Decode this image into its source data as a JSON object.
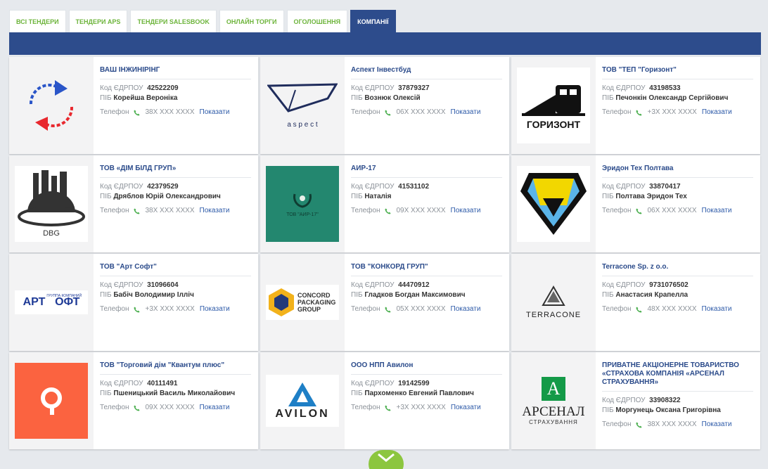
{
  "tabs": [
    {
      "label": "Всі тендери"
    },
    {
      "label": "Тендери APS"
    },
    {
      "label": "Тендери SalesBook"
    },
    {
      "label": "Онлайн торги"
    },
    {
      "label": "Оголошення"
    },
    {
      "label": "Компанії"
    }
  ],
  "labels": {
    "edrpou": "Код ЄДРПОУ",
    "pib": "ПІБ",
    "phone": "Телефон",
    "show": "Показати"
  },
  "logos": {
    "aspect_text": "a s p e c t",
    "horizont_text": "ГОРИЗОНТ",
    "dbg_text": "DBG",
    "air_text": "ТОВ \"АИР-17\"",
    "art_main": "АРТ",
    "art_soft": "ОФТ",
    "art_group": "ГРУППА КОМПАНИЙ",
    "concord_1": "CONCORD",
    "concord_2": "PACKAGING",
    "concord_3": "GROUP",
    "terracone_text": "TERRACONE",
    "avilon_text": "AVILON",
    "arsenal_letter": "A",
    "arsenal_main": "АРСЕНАЛ",
    "arsenal_sub": "СТРАХУВАННЯ"
  },
  "colors": {
    "brand_blue": "#2d4c8c",
    "tab_green": "#6db43b",
    "accent_green": "#8cc63f"
  },
  "companies": [
    {
      "name": "ВАШ ІНЖИНІРІНГ",
      "edrpou": "42522209",
      "pib": "Корейша Вероніка",
      "phone": "38X XXX XXXX"
    },
    {
      "name": "Аспект Інвестбуд",
      "edrpou": "37879327",
      "pib": "Вознюк Олексій",
      "phone": "06X XXX XXXX"
    },
    {
      "name": "ТОВ \"ТЕП \"Горизонт\"",
      "edrpou": "43198533",
      "pib": "Печонкін Олександр Сергійович",
      "phone": "+3X XXX XXXX"
    },
    {
      "name": "ТОВ «ДІМ БІЛД ГРУП»",
      "edrpou": "42379529",
      "pib": "Дряблов Юрій Олександрович",
      "phone": "38X XXX XXXX"
    },
    {
      "name": "АИР-17",
      "edrpou": "41531102",
      "pib": "Наталія",
      "phone": "09X XXX XXXX"
    },
    {
      "name": "Эридон Тех Полтава",
      "edrpou": "33870417",
      "pib": "Полтава Эридон Тех",
      "phone": "06X XXX XXXX"
    },
    {
      "name": "ТОВ \"Арт Софт\"",
      "edrpou": "31096604",
      "pib": "Бабіч Володимир Ілліч",
      "phone": "+3X XXX XXXX"
    },
    {
      "name": "ТОВ \"КОНКОРД ГРУП\"",
      "edrpou": "44470912",
      "pib": "Гладков Богдан Максимович",
      "phone": "05X XXX XXXX"
    },
    {
      "name": "Terracone Sp. z o.o.",
      "edrpou": "9731076502",
      "pib": "Анастасия Крапелла",
      "phone": "48X XXX XXXX"
    },
    {
      "name": "ТОВ \"Торговий дім \"Квантум плюс\"",
      "edrpou": "40111491",
      "pib": "Пшеницький Василь Миколайович",
      "phone": "09X XXX XXXX"
    },
    {
      "name": "ООО НПП Авилон",
      "edrpou": "19142599",
      "pib": "Пархоменко Евгений Павлович",
      "phone": "+3X XXX XXXX"
    },
    {
      "name": "ПРИВАТНЕ АКЦІОНЕРНЕ ТОВАРИСТВО «СТРАХОВА КОМПАНІЯ «АРСЕНАЛ СТРАХУВАННЯ»",
      "edrpou": "33908322",
      "pib": "Моргунець Оксана Григорівна",
      "phone": "38X XXX XXXX"
    }
  ]
}
